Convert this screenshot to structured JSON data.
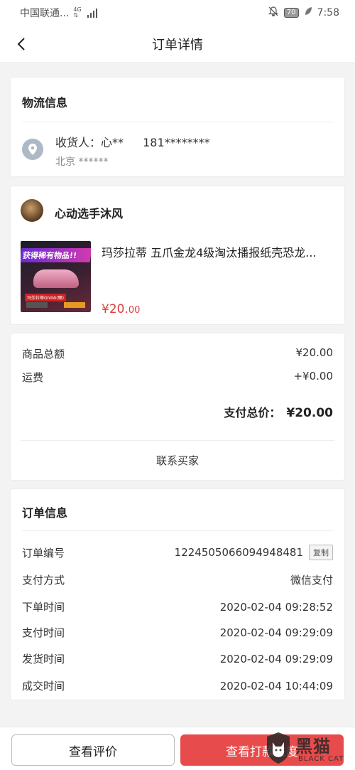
{
  "status_bar": {
    "carrier": "中国联通...",
    "network_top": "4G",
    "network_bottom": "⇅",
    "battery": "70",
    "time": "7:58"
  },
  "nav": {
    "title": "订单详情"
  },
  "logistics": {
    "title": "物流信息",
    "receiver_label": "收货人：心**",
    "phone": "181********",
    "address": "北京 ******"
  },
  "product": {
    "seller": "心动选手沐风",
    "thumb_banner": "获得稀有物品!!",
    "thumb_label": "玛莎拉蒂Ghibli(臻)",
    "name": "玛莎拉蒂 五爪金龙4级淘汰播报纸壳恐龙...",
    "price_main": "¥20.",
    "price_decimal": "00"
  },
  "summary": {
    "goods_total_label": "商品总额",
    "goods_total_value": "¥20.00",
    "shipping_label": "运费",
    "shipping_value": "+¥0.00",
    "total_label": "支付总价：",
    "total_value": "¥20.00",
    "contact": "联系买家"
  },
  "order_info": {
    "title": "订单信息",
    "rows": [
      {
        "label": "订单编号",
        "value": "1224505066094948481"
      },
      {
        "label": "支付方式",
        "value": "微信支付"
      },
      {
        "label": "下单时间",
        "value": "2020-02-04 09:28:52"
      },
      {
        "label": "支付时间",
        "value": "2020-02-04 09:29:09"
      },
      {
        "label": "发货时间",
        "value": "2020-02-04 09:29:09"
      },
      {
        "label": "成交时间",
        "value": "2020-02-04 10:44:09"
      }
    ],
    "copy_label": "复制"
  },
  "bottom": {
    "review_label": "查看评价",
    "pay_label": "查看打款进度"
  },
  "watermark": {
    "text": "黑猫",
    "sub": "BLACK CAT"
  },
  "colors": {
    "accent": "#e84b4b",
    "price": "#e0403c",
    "location_icon_bg": "#aeb9c7",
    "background": "#f3f3f3"
  }
}
